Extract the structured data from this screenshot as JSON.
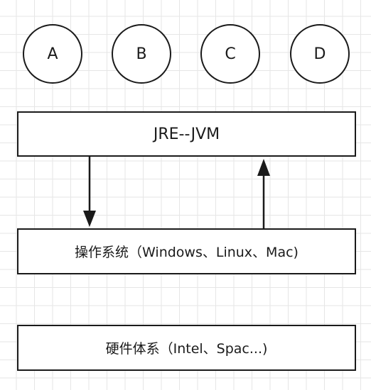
{
  "circles": [
    {
      "label": "A"
    },
    {
      "label": "B"
    },
    {
      "label": "C"
    },
    {
      "label": "D"
    }
  ],
  "jre_box": {
    "label": "JRE--JVM"
  },
  "os_box": {
    "label": "操作系统（Windows、Linux、Mac)"
  },
  "hardware_box": {
    "label": "硬件体系（Intel、Spac...)"
  }
}
